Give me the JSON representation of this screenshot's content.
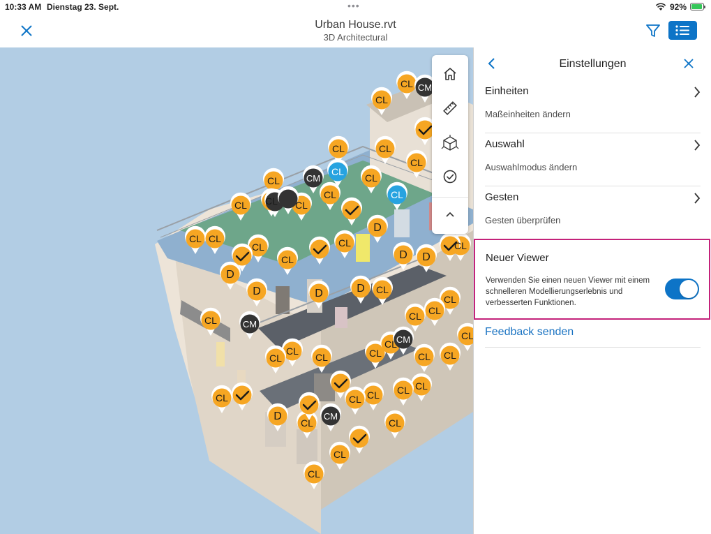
{
  "status_bar": {
    "time": "10:33 AM",
    "date": "Dienstag 23. Sept.",
    "battery": "92%"
  },
  "header": {
    "title": "Urban House.rvt",
    "subtitle": "3D Architectural",
    "accent_color": "#0d74c7"
  },
  "viewer": {
    "background_color": "#b2cde4",
    "toolbar": [
      "home-icon",
      "measure-icon",
      "model-cube-icon",
      "checkmark-circle-icon",
      "chevron-up-icon"
    ],
    "pins": {
      "CL": "CL",
      "CM": "CM",
      "D": "D"
    }
  },
  "settings_panel": {
    "title": "Einstellungen",
    "items": [
      {
        "label": "Einheiten",
        "description": "Maßeinheiten ändern"
      },
      {
        "label": "Auswahl",
        "description": "Auswahlmodus ändern"
      },
      {
        "label": "Gesten",
        "description": "Gesten überprüfen"
      }
    ],
    "new_viewer": {
      "title": "Neuer Viewer",
      "description": "Verwenden Sie einen neuen Viewer mit einem schnelleren Modellierungserlebnis und verbesserten Funktionen.",
      "enabled": true,
      "highlight_color": "#c4227a"
    },
    "feedback": "Feedback senden"
  }
}
